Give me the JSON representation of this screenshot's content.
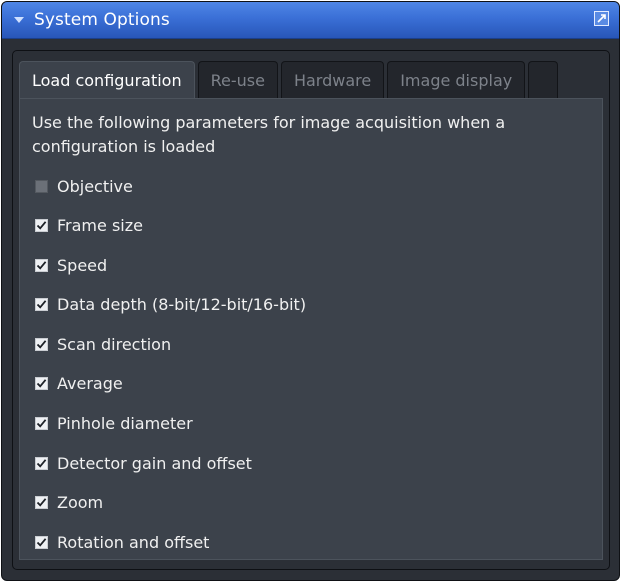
{
  "window": {
    "title": "System Options"
  },
  "tabs": [
    {
      "label": "Load configuration",
      "active": true
    },
    {
      "label": "Re-use",
      "active": false
    },
    {
      "label": "Hardware",
      "active": false
    },
    {
      "label": "Image display",
      "active": false
    }
  ],
  "description": "Use the following parameters for image acquisition when a configuration is loaded",
  "options": [
    {
      "label": "Objective",
      "checked": false
    },
    {
      "label": "Frame size",
      "checked": true
    },
    {
      "label": "Speed",
      "checked": true
    },
    {
      "label": "Data depth (8-bit/12-bit/16-bit)",
      "checked": true
    },
    {
      "label": "Scan direction",
      "checked": true
    },
    {
      "label": "Average",
      "checked": true
    },
    {
      "label": "Pinhole diameter",
      "checked": true
    },
    {
      "label": "Detector gain and offset",
      "checked": true
    },
    {
      "label": "Zoom",
      "checked": true
    },
    {
      "label": "Rotation and offset",
      "checked": true
    }
  ],
  "colors": {
    "title_bar": "#3a6fd6",
    "panel_bg": "#2b2f36",
    "tab_active_bg": "#3c424b"
  },
  "icons": {
    "collapse": "triangle-down-icon",
    "undock": "undock-icon",
    "checkbox": "checkmark-icon"
  }
}
